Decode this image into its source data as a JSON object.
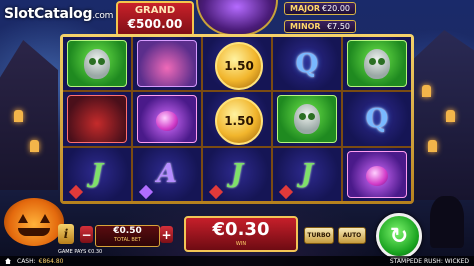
{
  "watermark": {
    "brand": "SlotCatalog",
    "suffix": ".com"
  },
  "jackpots": {
    "grand": {
      "label": "GRAND",
      "value": "€500.00"
    },
    "major": {
      "label": "MAJOR",
      "value": "€20.00"
    },
    "minor": {
      "label": "MINOR",
      "value": "€7.50"
    }
  },
  "reels": [
    [
      "owl",
      "witch",
      "coin",
      "Q",
      "owl"
    ],
    [
      "cat",
      "potion",
      "coin",
      "owl",
      "Q"
    ],
    [
      "J",
      "A",
      "J",
      "J",
      "potion"
    ]
  ],
  "coin_values": [
    "1.50",
    "1.50"
  ],
  "controls": {
    "info_label": "i",
    "minus_label": "−",
    "plus_label": "+",
    "bet_value": "€0.50",
    "bet_label": "TOTAL BET",
    "win_value": "€0.30",
    "win_label": "WIN",
    "turbo_label": "TURBO",
    "auto_label": "AUTO",
    "spin_icon": "↻"
  },
  "game_pays": "GAME PAYS €0.30",
  "footer": {
    "cash_label": "CASH:",
    "cash_value": "€864.80",
    "game_name": "STAMPEDE RUSH: WICKED"
  }
}
